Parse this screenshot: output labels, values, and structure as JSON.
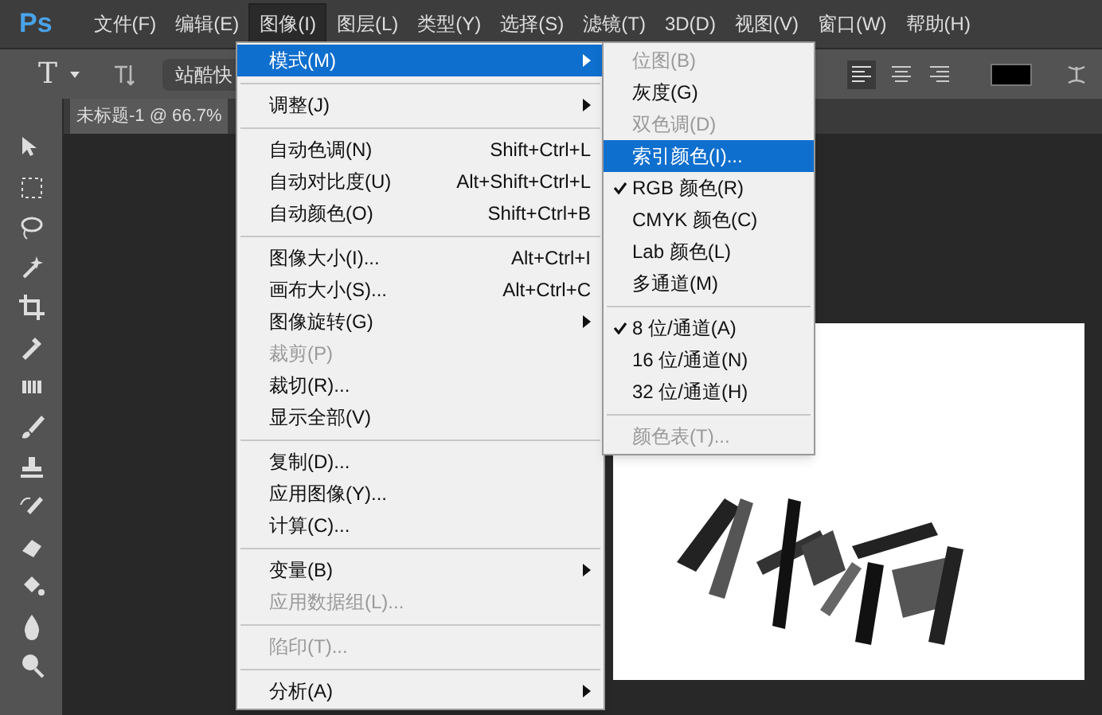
{
  "menubar": {
    "logo": "Ps",
    "items": [
      {
        "label": "文件(F)",
        "selected": false
      },
      {
        "label": "编辑(E)",
        "selected": false
      },
      {
        "label": "图像(I)",
        "selected": true
      },
      {
        "label": "图层(L)",
        "selected": false
      },
      {
        "label": "类型(Y)",
        "selected": false
      },
      {
        "label": "选择(S)",
        "selected": false
      },
      {
        "label": "滤镜(T)",
        "selected": false
      },
      {
        "label": "3D(D)",
        "selected": false
      },
      {
        "label": "视图(V)",
        "selected": false
      },
      {
        "label": "窗口(W)",
        "selected": false
      },
      {
        "label": "帮助(H)",
        "selected": false
      }
    ]
  },
  "options_bar": {
    "tool": "T",
    "font_field": "站酷快"
  },
  "document_tab": {
    "title": "未标题-1 @ 66.7%"
  },
  "image_menu": [
    {
      "kind": "item",
      "label": "模式(M)",
      "submenu": true,
      "selected": true,
      "disabled": false
    },
    {
      "kind": "separator"
    },
    {
      "kind": "item",
      "label": "调整(J)",
      "submenu": true,
      "selected": false,
      "disabled": false
    },
    {
      "kind": "separator"
    },
    {
      "kind": "item",
      "label": "自动色调(N)",
      "shortcut": "Shift+Ctrl+L",
      "submenu": false,
      "selected": false,
      "disabled": false
    },
    {
      "kind": "item",
      "label": "自动对比度(U)",
      "shortcut": "Alt+Shift+Ctrl+L",
      "submenu": false,
      "selected": false,
      "disabled": false
    },
    {
      "kind": "item",
      "label": "自动颜色(O)",
      "shortcut": "Shift+Ctrl+B",
      "submenu": false,
      "selected": false,
      "disabled": false
    },
    {
      "kind": "separator"
    },
    {
      "kind": "item",
      "label": "图像大小(I)...",
      "shortcut": "Alt+Ctrl+I",
      "submenu": false,
      "selected": false,
      "disabled": false
    },
    {
      "kind": "item",
      "label": "画布大小(S)...",
      "shortcut": "Alt+Ctrl+C",
      "submenu": false,
      "selected": false,
      "disabled": false
    },
    {
      "kind": "item",
      "label": "图像旋转(G)",
      "submenu": true,
      "selected": false,
      "disabled": false
    },
    {
      "kind": "item",
      "label": "裁剪(P)",
      "submenu": false,
      "selected": false,
      "disabled": true
    },
    {
      "kind": "item",
      "label": "裁切(R)...",
      "submenu": false,
      "selected": false,
      "disabled": false
    },
    {
      "kind": "item",
      "label": "显示全部(V)",
      "submenu": false,
      "selected": false,
      "disabled": false
    },
    {
      "kind": "separator"
    },
    {
      "kind": "item",
      "label": "复制(D)...",
      "submenu": false,
      "selected": false,
      "disabled": false
    },
    {
      "kind": "item",
      "label": "应用图像(Y)...",
      "submenu": false,
      "selected": false,
      "disabled": false
    },
    {
      "kind": "item",
      "label": "计算(C)...",
      "submenu": false,
      "selected": false,
      "disabled": false
    },
    {
      "kind": "separator"
    },
    {
      "kind": "item",
      "label": "变量(B)",
      "submenu": true,
      "selected": false,
      "disabled": false
    },
    {
      "kind": "item",
      "label": "应用数据组(L)...",
      "submenu": false,
      "selected": false,
      "disabled": true
    },
    {
      "kind": "separator"
    },
    {
      "kind": "item",
      "label": "陷印(T)...",
      "submenu": false,
      "selected": false,
      "disabled": true
    },
    {
      "kind": "separator"
    },
    {
      "kind": "item",
      "label": "分析(A)",
      "submenu": true,
      "selected": false,
      "disabled": false
    }
  ],
  "mode_submenu": [
    {
      "kind": "item",
      "label": "位图(B)",
      "checked": false,
      "selected": false,
      "disabled": true
    },
    {
      "kind": "item",
      "label": "灰度(G)",
      "checked": false,
      "selected": false,
      "disabled": false
    },
    {
      "kind": "item",
      "label": "双色调(D)",
      "checked": false,
      "selected": false,
      "disabled": true
    },
    {
      "kind": "item",
      "label": "索引颜色(I)...",
      "checked": false,
      "selected": true,
      "disabled": false
    },
    {
      "kind": "item",
      "label": "RGB 颜色(R)",
      "checked": true,
      "selected": false,
      "disabled": false
    },
    {
      "kind": "item",
      "label": "CMYK 颜色(C)",
      "checked": false,
      "selected": false,
      "disabled": false
    },
    {
      "kind": "item",
      "label": "Lab 颜色(L)",
      "checked": false,
      "selected": false,
      "disabled": false
    },
    {
      "kind": "item",
      "label": "多通道(M)",
      "checked": false,
      "selected": false,
      "disabled": false
    },
    {
      "kind": "separator"
    },
    {
      "kind": "item",
      "label": "8 位/通道(A)",
      "checked": true,
      "selected": false,
      "disabled": false
    },
    {
      "kind": "item",
      "label": "16 位/通道(N)",
      "checked": false,
      "selected": false,
      "disabled": false
    },
    {
      "kind": "item",
      "label": "32 位/通道(H)",
      "checked": false,
      "selected": false,
      "disabled": false
    },
    {
      "kind": "separator"
    },
    {
      "kind": "item",
      "label": "颜色表(T)...",
      "checked": false,
      "selected": false,
      "disabled": true
    }
  ]
}
